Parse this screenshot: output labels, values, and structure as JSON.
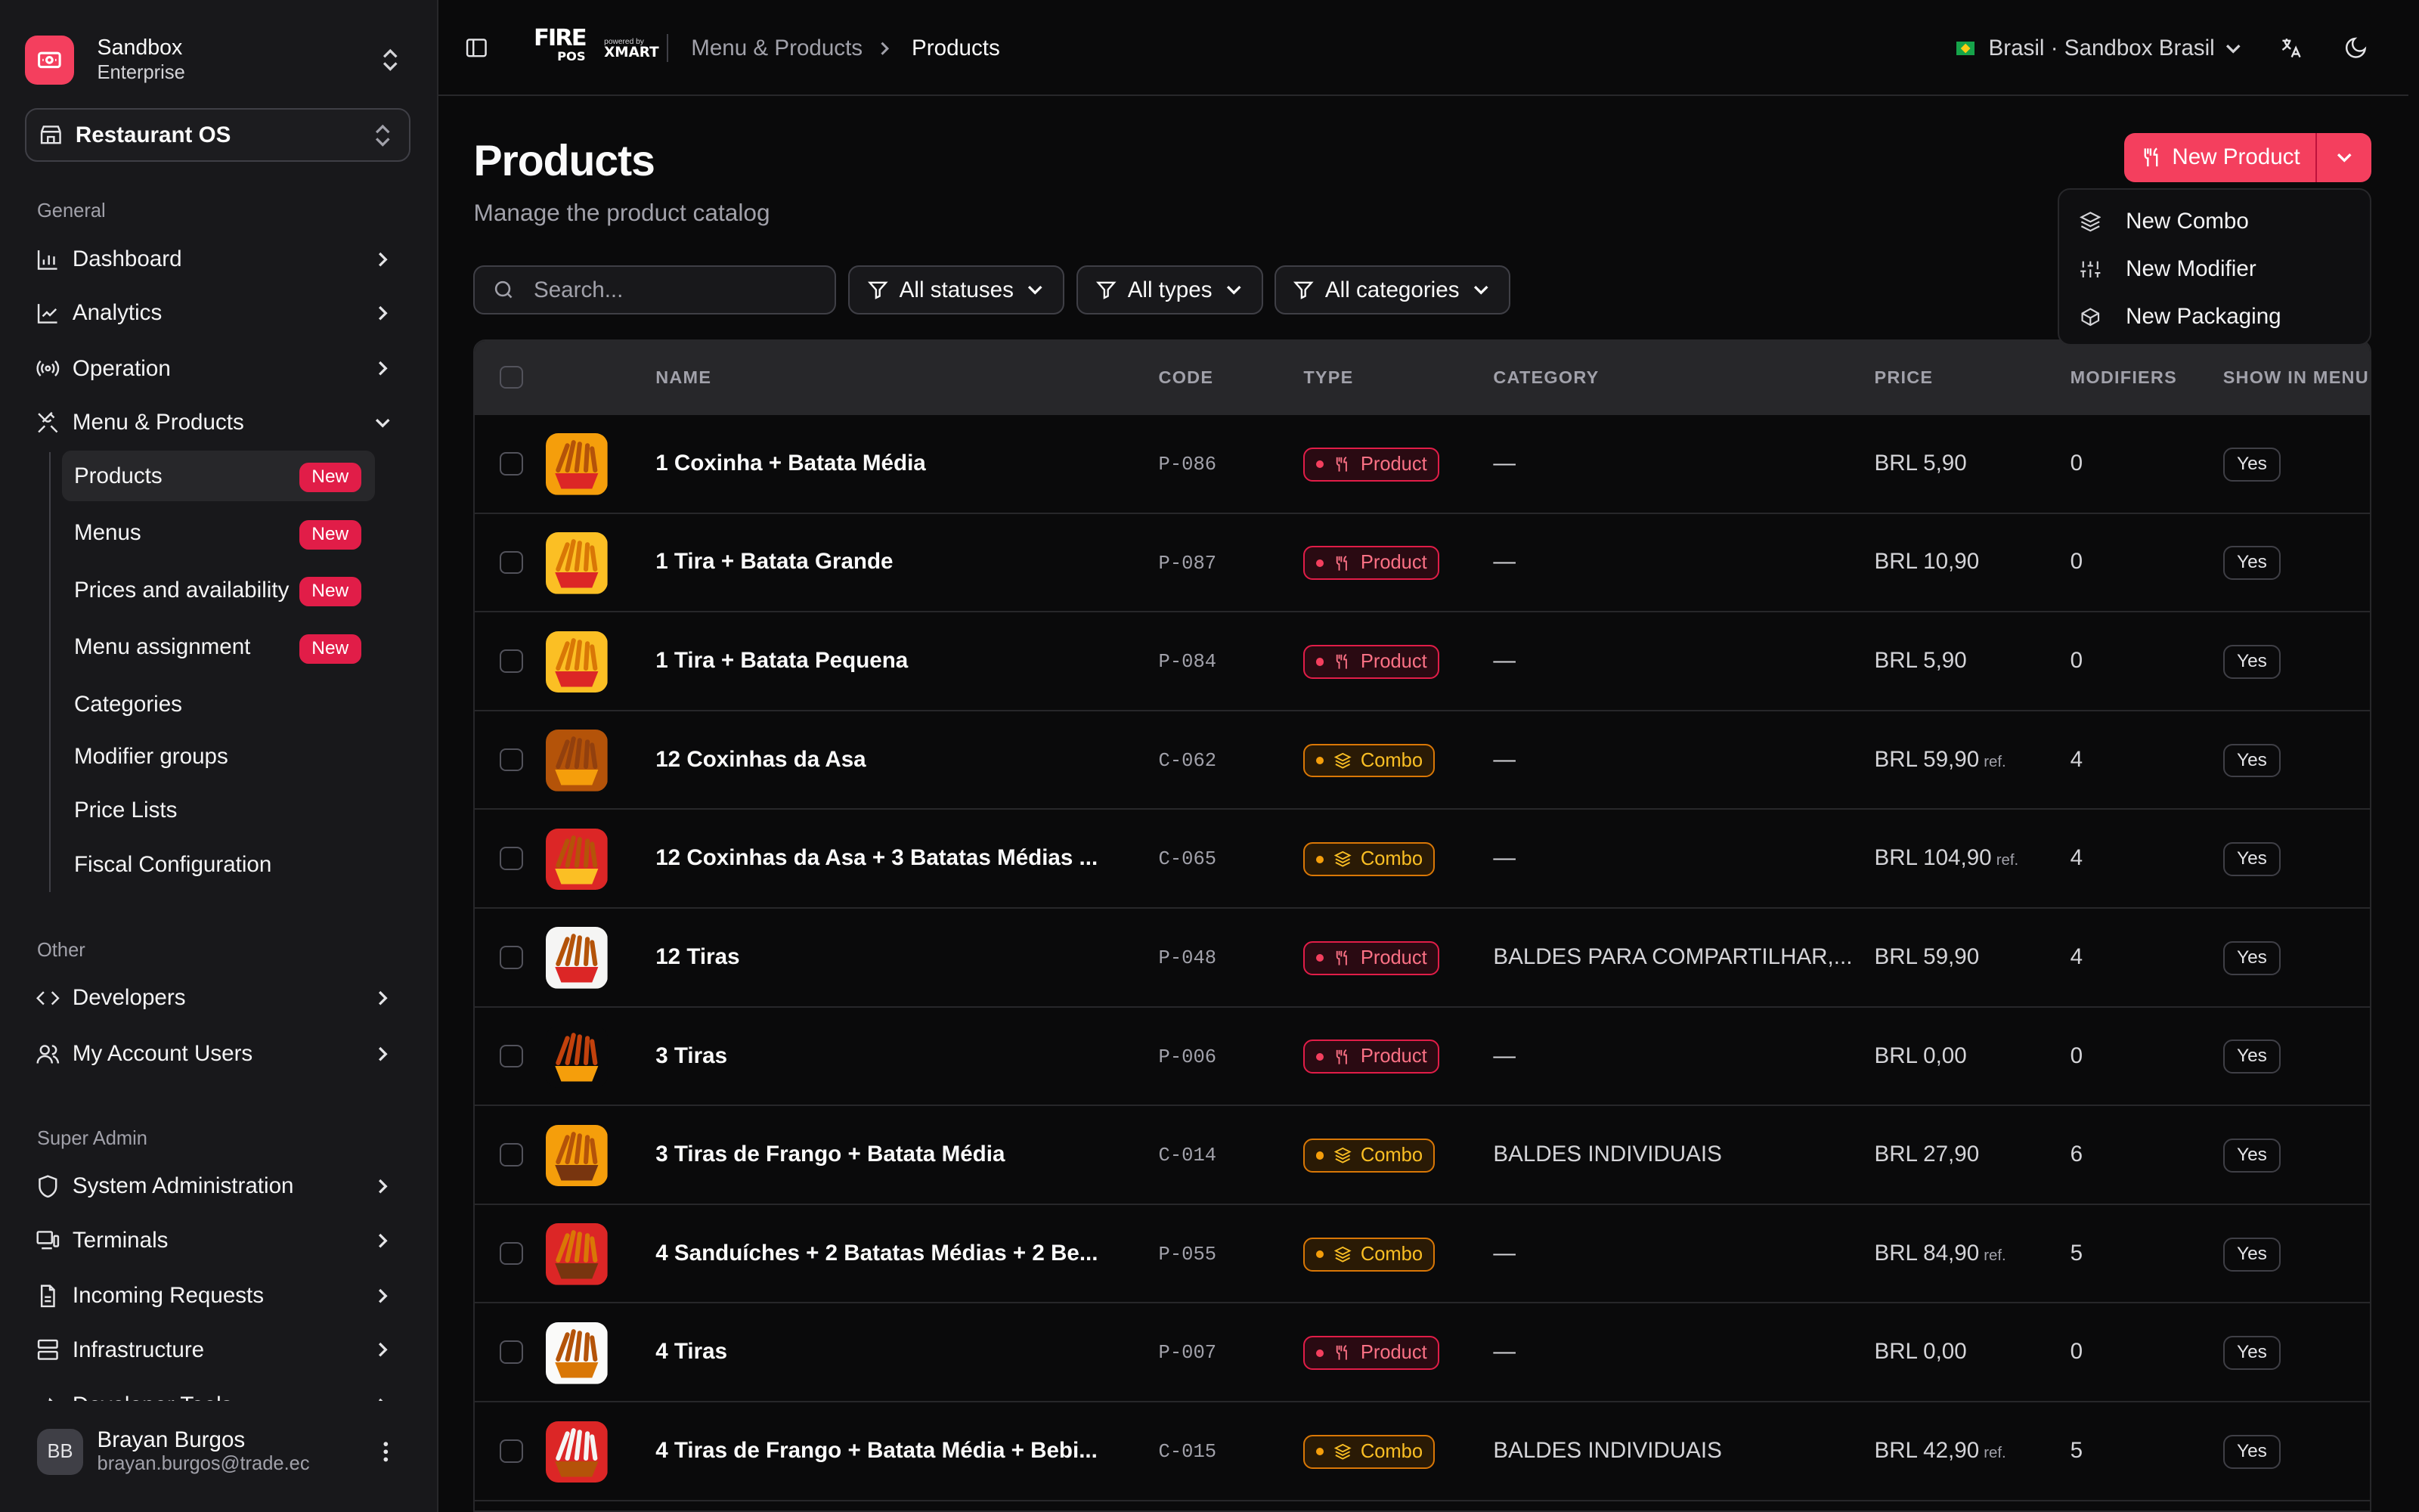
{
  "workspace": {
    "name": "Sandbox",
    "plan": "Enterprise"
  },
  "org": {
    "name": "Restaurant OS"
  },
  "sidebar": {
    "general_label": "General",
    "general": [
      {
        "label": "Dashboard",
        "icon": "bar-chart-icon"
      },
      {
        "label": "Analytics",
        "icon": "line-chart-icon"
      },
      {
        "label": "Operation",
        "icon": "radio-icon"
      },
      {
        "label": "Menu & Products",
        "icon": "utensils-icon"
      }
    ],
    "menu_products_sub": [
      {
        "label": "Products",
        "badge": "New"
      },
      {
        "label": "Menus",
        "badge": "New"
      },
      {
        "label": "Prices and availability",
        "badge": "New"
      },
      {
        "label": "Menu assignment",
        "badge": "New"
      },
      {
        "label": "Categories"
      },
      {
        "label": "Modifier groups"
      },
      {
        "label": "Price Lists"
      },
      {
        "label": "Fiscal Configuration"
      }
    ],
    "other_label": "Other",
    "other": [
      {
        "label": "Developers",
        "icon": "code-icon"
      },
      {
        "label": "My Account Users",
        "icon": "users-icon"
      }
    ],
    "super_label": "Super Admin",
    "super": [
      {
        "label": "System Administration",
        "icon": "shield-icon"
      },
      {
        "label": "Terminals",
        "icon": "terminal-icon"
      },
      {
        "label": "Incoming Requests",
        "icon": "file-icon"
      },
      {
        "label": "Infrastructure",
        "icon": "server-icon"
      },
      {
        "label": "Developer Tools",
        "icon": "wrench-icon"
      }
    ]
  },
  "user": {
    "initials": "BB",
    "name": "Brayan Burgos",
    "email": "brayan.burgos@trade.ec"
  },
  "topbar": {
    "brand_fire": "FIRE",
    "brand_pos": "POS",
    "brand_powered": "powered by",
    "brand_xmart": "XMART",
    "breadcrumb": [
      "Menu & Products",
      "Products"
    ],
    "country": "Brasil · Sandbox Brasil"
  },
  "page": {
    "title": "Products",
    "subtitle": "Manage the product catalog"
  },
  "new_button": {
    "label": "New Product"
  },
  "dropdown": [
    {
      "label": "New Combo",
      "icon": "layers-icon"
    },
    {
      "label": "New Modifier",
      "icon": "sliders-icon"
    },
    {
      "label": "New Packaging",
      "icon": "box-icon"
    }
  ],
  "filters": {
    "search_placeholder": "Search...",
    "statuses": "All statuses",
    "types": "All types",
    "categories": "All categories"
  },
  "table": {
    "headers": {
      "name": "NAME",
      "code": "CODE",
      "type": "TYPE",
      "category": "CATEGORY",
      "price": "PRICE",
      "modifiers": "MODIFIERS",
      "show": "SHOW IN MENU"
    },
    "ref_label": "ref.",
    "rows": [
      {
        "name": "1 Coxinha + Batata Média",
        "code": "P-086",
        "type": "Product",
        "category": "—",
        "price": "BRL 5,90",
        "ref": false,
        "modifiers": "0",
        "show": "Yes"
      },
      {
        "name": "1 Tira + Batata Grande",
        "code": "P-087",
        "type": "Product",
        "category": "—",
        "price": "BRL 10,90",
        "ref": false,
        "modifiers": "0",
        "show": "Yes"
      },
      {
        "name": "1 Tira + Batata Pequena",
        "code": "P-084",
        "type": "Product",
        "category": "—",
        "price": "BRL 5,90",
        "ref": false,
        "modifiers": "0",
        "show": "Yes"
      },
      {
        "name": "12 Coxinhas da Asa",
        "code": "C-062",
        "type": "Combo",
        "category": "—",
        "price": "BRL 59,90",
        "ref": true,
        "modifiers": "4",
        "show": "Yes"
      },
      {
        "name": "12 Coxinhas da Asa + 3 Batatas Médias ...",
        "code": "C-065",
        "type": "Combo",
        "category": "—",
        "price": "BRL 104,90",
        "ref": true,
        "modifiers": "4",
        "show": "Yes"
      },
      {
        "name": "12 Tiras",
        "code": "P-048",
        "type": "Product",
        "category": "BALDES PARA COMPARTILHAR,...",
        "price": "BRL 59,90",
        "ref": false,
        "modifiers": "4",
        "show": "Yes"
      },
      {
        "name": "3 Tiras",
        "code": "P-006",
        "type": "Product",
        "category": "—",
        "price": "BRL 0,00",
        "ref": false,
        "modifiers": "0",
        "show": "Yes"
      },
      {
        "name": "3 Tiras de Frango + Batata Média",
        "code": "C-014",
        "type": "Combo",
        "category": "BALDES INDIVIDUAIS",
        "price": "BRL 27,90",
        "ref": false,
        "modifiers": "6",
        "show": "Yes"
      },
      {
        "name": "4 Sanduíches + 2 Batatas Médias + 2 Be...",
        "code": "P-055",
        "type": "Combo",
        "category": "—",
        "price": "BRL 84,90",
        "ref": true,
        "modifiers": "5",
        "show": "Yes"
      },
      {
        "name": "4 Tiras",
        "code": "P-007",
        "type": "Product",
        "category": "—",
        "price": "BRL 0,00",
        "ref": false,
        "modifiers": "0",
        "show": "Yes"
      },
      {
        "name": "4 Tiras de Frango + Batata Média + Bebi...",
        "code": "C-015",
        "type": "Combo",
        "category": "BALDES INDIVIDUAIS",
        "price": "BRL 42,90",
        "ref": true,
        "modifiers": "5",
        "show": "Yes"
      }
    ]
  }
}
